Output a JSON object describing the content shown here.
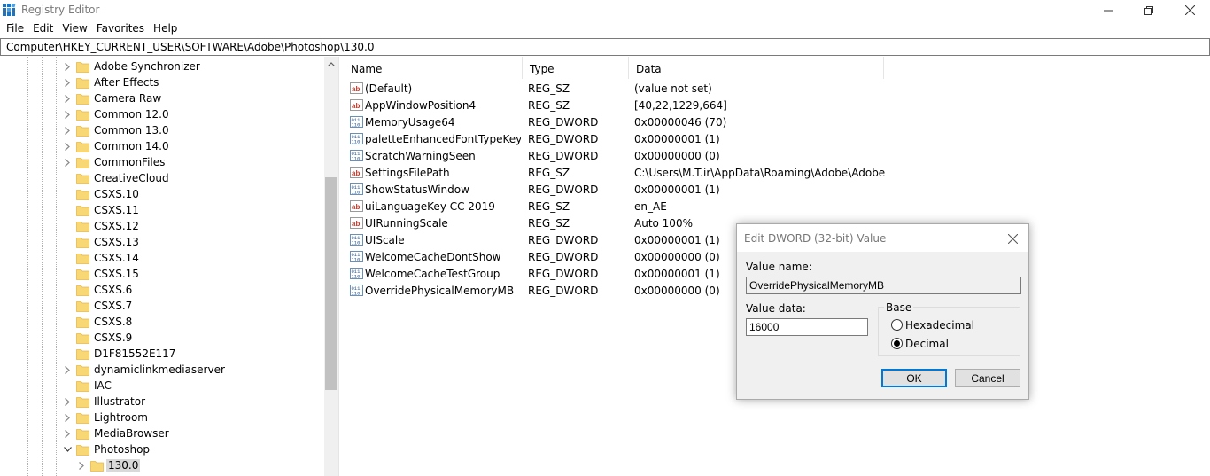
{
  "window": {
    "title": "Registry Editor"
  },
  "menu": [
    "File",
    "Edit",
    "View",
    "Favorites",
    "Help"
  ],
  "address": "Computer\\HKEY_CURRENT_USER\\SOFTWARE\\Adobe\\Photoshop\\130.0",
  "tree": {
    "items": [
      {
        "label": "Adobe Synchronizer",
        "expandable": true
      },
      {
        "label": "After Effects",
        "expandable": true
      },
      {
        "label": "Camera Raw",
        "expandable": true
      },
      {
        "label": "Common 12.0",
        "expandable": true
      },
      {
        "label": "Common 13.0",
        "expandable": true
      },
      {
        "label": "Common 14.0",
        "expandable": true
      },
      {
        "label": "CommonFiles",
        "expandable": true
      },
      {
        "label": "CreativeCloud",
        "expandable": false
      },
      {
        "label": "CSXS.10",
        "expandable": false
      },
      {
        "label": "CSXS.11",
        "expandable": false
      },
      {
        "label": "CSXS.12",
        "expandable": false
      },
      {
        "label": "CSXS.13",
        "expandable": false
      },
      {
        "label": "CSXS.14",
        "expandable": false
      },
      {
        "label": "CSXS.15",
        "expandable": false
      },
      {
        "label": "CSXS.6",
        "expandable": false
      },
      {
        "label": "CSXS.7",
        "expandable": false
      },
      {
        "label": "CSXS.8",
        "expandable": false
      },
      {
        "label": "CSXS.9",
        "expandable": false
      },
      {
        "label": "D1F81552E117",
        "expandable": false
      },
      {
        "label": "dynamiclinkmediaserver",
        "expandable": true
      },
      {
        "label": "IAC",
        "expandable": false
      },
      {
        "label": "Illustrator",
        "expandable": true
      },
      {
        "label": "Lightroom",
        "expandable": true
      },
      {
        "label": "MediaBrowser",
        "expandable": true
      },
      {
        "label": "Photoshop",
        "expandable": true,
        "expanded": true
      },
      {
        "label": "130.0",
        "expandable": true,
        "child": true,
        "selected": true
      }
    ]
  },
  "list": {
    "columns": {
      "name": "Name",
      "type": "Type",
      "data": "Data"
    },
    "rows": [
      {
        "icon": "string",
        "name": "(Default)",
        "type": "REG_SZ",
        "data": "(value not set)"
      },
      {
        "icon": "string",
        "name": "AppWindowPosition4",
        "type": "REG_SZ",
        "data": "[40,22,1229,664]"
      },
      {
        "icon": "binary",
        "name": "MemoryUsage64",
        "type": "REG_DWORD",
        "data": "0x00000046 (70)"
      },
      {
        "icon": "binary",
        "name": "paletteEnhancedFontTypeKey C...",
        "type": "REG_DWORD",
        "data": "0x00000001 (1)"
      },
      {
        "icon": "binary",
        "name": "ScratchWarningSeen",
        "type": "REG_DWORD",
        "data": "0x00000000 (0)"
      },
      {
        "icon": "string",
        "name": "SettingsFilePath",
        "type": "REG_SZ",
        "data": "C:\\Users\\M.T.ir\\AppData\\Roaming\\Adobe\\Adobe ..."
      },
      {
        "icon": "binary",
        "name": "ShowStatusWindow",
        "type": "REG_DWORD",
        "data": "0x00000001 (1)"
      },
      {
        "icon": "string",
        "name": "uiLanguageKey CC 2019",
        "type": "REG_SZ",
        "data": "en_AE"
      },
      {
        "icon": "string",
        "name": "UIRunningScale",
        "type": "REG_SZ",
        "data": "Auto 100%"
      },
      {
        "icon": "binary",
        "name": "UIScale",
        "type": "REG_DWORD",
        "data": "0x00000001 (1)"
      },
      {
        "icon": "binary",
        "name": "WelcomeCacheDontShow",
        "type": "REG_DWORD",
        "data": "0x00000000 (0)"
      },
      {
        "icon": "binary",
        "name": "WelcomeCacheTestGroup",
        "type": "REG_DWORD",
        "data": "0x00000001 (1)"
      },
      {
        "icon": "binary",
        "name": "OverridePhysicalMemoryMB",
        "type": "REG_DWORD",
        "data": "0x00000000 (0)",
        "selected": true
      }
    ]
  },
  "dialog": {
    "title": "Edit DWORD (32-bit) Value",
    "value_name_label": "Value name:",
    "value_name": "OverridePhysicalMemoryMB",
    "value_data_label": "Value data:",
    "value_data": "16000",
    "base_label": "Base",
    "hex_label": "Hexadecimal",
    "dec_label": "Decimal",
    "selected_base": "decimal",
    "ok_label": "OK",
    "cancel_label": "Cancel"
  },
  "colors": {
    "folder": "#f8d775",
    "folder_dark": "#e6b84a",
    "accent": "#0078d7",
    "selection": "#d9d9d9"
  }
}
